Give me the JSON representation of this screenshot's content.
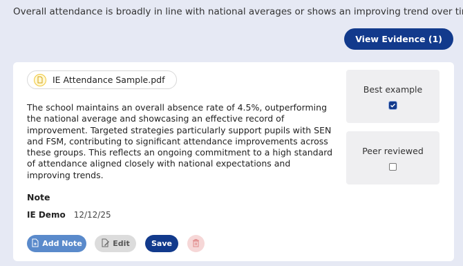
{
  "criterion": "Overall attendance is broadly in line with national averages or shows an improving trend over time",
  "view_evidence_label": "View Evidence (1)",
  "evidence": {
    "file_name": "IE Attendance Sample.pdf",
    "summary": "The school maintains an overall absence rate of 4.5%, outperforming the national average and showcasing an effective record of improvement. Targeted strategies particularly support pupils with SEN and FSM, contributing to significant attendance improvements across these groups. This reflects an ongoing commitment to a high standard of attendance aligned closely with national expectations and improving trends.",
    "best_example": {
      "label": "Best example",
      "checked": true
    },
    "peer_reviewed": {
      "label": "Peer reviewed",
      "checked": false
    }
  },
  "note": {
    "heading": "Note",
    "author": "IE Demo",
    "date": "12/12/25"
  },
  "actions": {
    "add_note": "Add Note",
    "edit": "Edit",
    "save": "Save"
  }
}
